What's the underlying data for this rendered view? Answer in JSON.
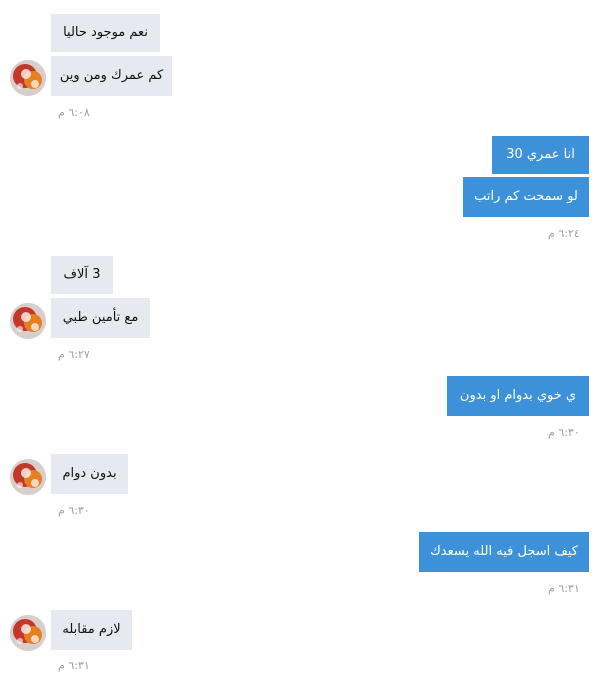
{
  "messages": [
    {
      "side": "incoming",
      "text": "نعم موجود حاليا"
    },
    {
      "side": "incoming",
      "text": "كم عمرك ومن وين"
    },
    {
      "side": "incoming",
      "time": "٦:٠٨ م"
    },
    {
      "side": "outgoing",
      "text": "انا عمري 30"
    },
    {
      "side": "outgoing",
      "text": "لو سمحت كم  راتب"
    },
    {
      "side": "outgoing",
      "time": "٦:٢٤ م"
    },
    {
      "side": "incoming",
      "text": "3 آلاف"
    },
    {
      "side": "incoming",
      "text": "مع تأمين طبي"
    },
    {
      "side": "incoming",
      "time": "٦:٢٧ م"
    },
    {
      "side": "outgoing",
      "text": "ي خوي بدوام او بدون"
    },
    {
      "side": "outgoing",
      "time": "٦:٣٠ م"
    },
    {
      "side": "incoming",
      "text": "بدون دوام"
    },
    {
      "side": "incoming",
      "time": "٦:٣٠ م"
    },
    {
      "side": "outgoing",
      "text": "كيف اسجل فيه  الله يسعدك"
    },
    {
      "side": "outgoing",
      "time": "٦:٣١ م"
    },
    {
      "side": "incoming",
      "text": "لازم مقابله"
    },
    {
      "side": "incoming",
      "time": "٦:٣١ م"
    }
  ],
  "icons": {
    "avatar": "contact-avatar-icon"
  },
  "colors": {
    "incoming_bubble": "#e6e9f0",
    "outgoing_bubble": "#3d91d9",
    "timestamp": "#9aa0a6"
  }
}
